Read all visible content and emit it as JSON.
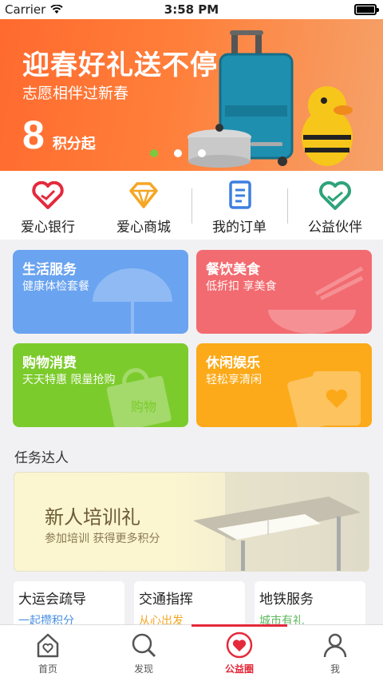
{
  "status_bar": {
    "carrier": "Carrier",
    "time": "3:58 PM"
  },
  "banner": {
    "headline": "迎春好礼送不停",
    "subtitle": "志愿相伴过新春",
    "points_value": "8",
    "points_unit": "积分起",
    "carousel_pages": 3,
    "carousel_active": 0
  },
  "quick_nav": [
    {
      "label": "爱心银行",
      "icon": "heart-icon"
    },
    {
      "label": "爱心商城",
      "icon": "diamond-icon"
    },
    {
      "label": "我的订单",
      "icon": "document-icon"
    },
    {
      "label": "公益伙伴",
      "icon": "handshake-heart-icon"
    }
  ],
  "categories": [
    {
      "title": "生活服务",
      "subtitle": "健康体检套餐",
      "color": "#6aa3f0",
      "icon": "umbrella-icon"
    },
    {
      "title": "餐饮美食",
      "subtitle": "低折扣 享美食",
      "color": "#f26b70",
      "icon": "bowl-chopsticks-icon"
    },
    {
      "title": "购物消费",
      "subtitle": "天天特惠 限量抢购",
      "color": "#7ccb2c",
      "icon": "shopping-bag-icon",
      "icon_text": "购物"
    },
    {
      "title": "休闲娱乐",
      "subtitle": "轻松享清闲",
      "color": "#fcaa1a",
      "icon": "heart-card-icon"
    }
  ],
  "section": {
    "title": "任务达人"
  },
  "promo": {
    "title": "新人培训礼",
    "subtitle": "参加培训 获得更多积分"
  },
  "tasks": [
    {
      "title": "大运会疏导",
      "subtitle": "一起攒积分",
      "sub_color": "#4a90e2"
    },
    {
      "title": "交通指挥",
      "subtitle": "从心出发",
      "sub_color": "#f5a623"
    },
    {
      "title": "地铁服务",
      "subtitle": "城市有礼",
      "sub_color": "#5cb85c"
    }
  ],
  "tabbar": [
    {
      "label": "首页",
      "icon": "home-icon"
    },
    {
      "label": "发现",
      "icon": "search-icon"
    },
    {
      "label": "公益圈",
      "icon": "heart-circle-icon",
      "active": true
    },
    {
      "label": "我",
      "icon": "user-icon"
    }
  ],
  "colors": {
    "accent": "#e5293b",
    "banner": "#ff6a2e"
  }
}
